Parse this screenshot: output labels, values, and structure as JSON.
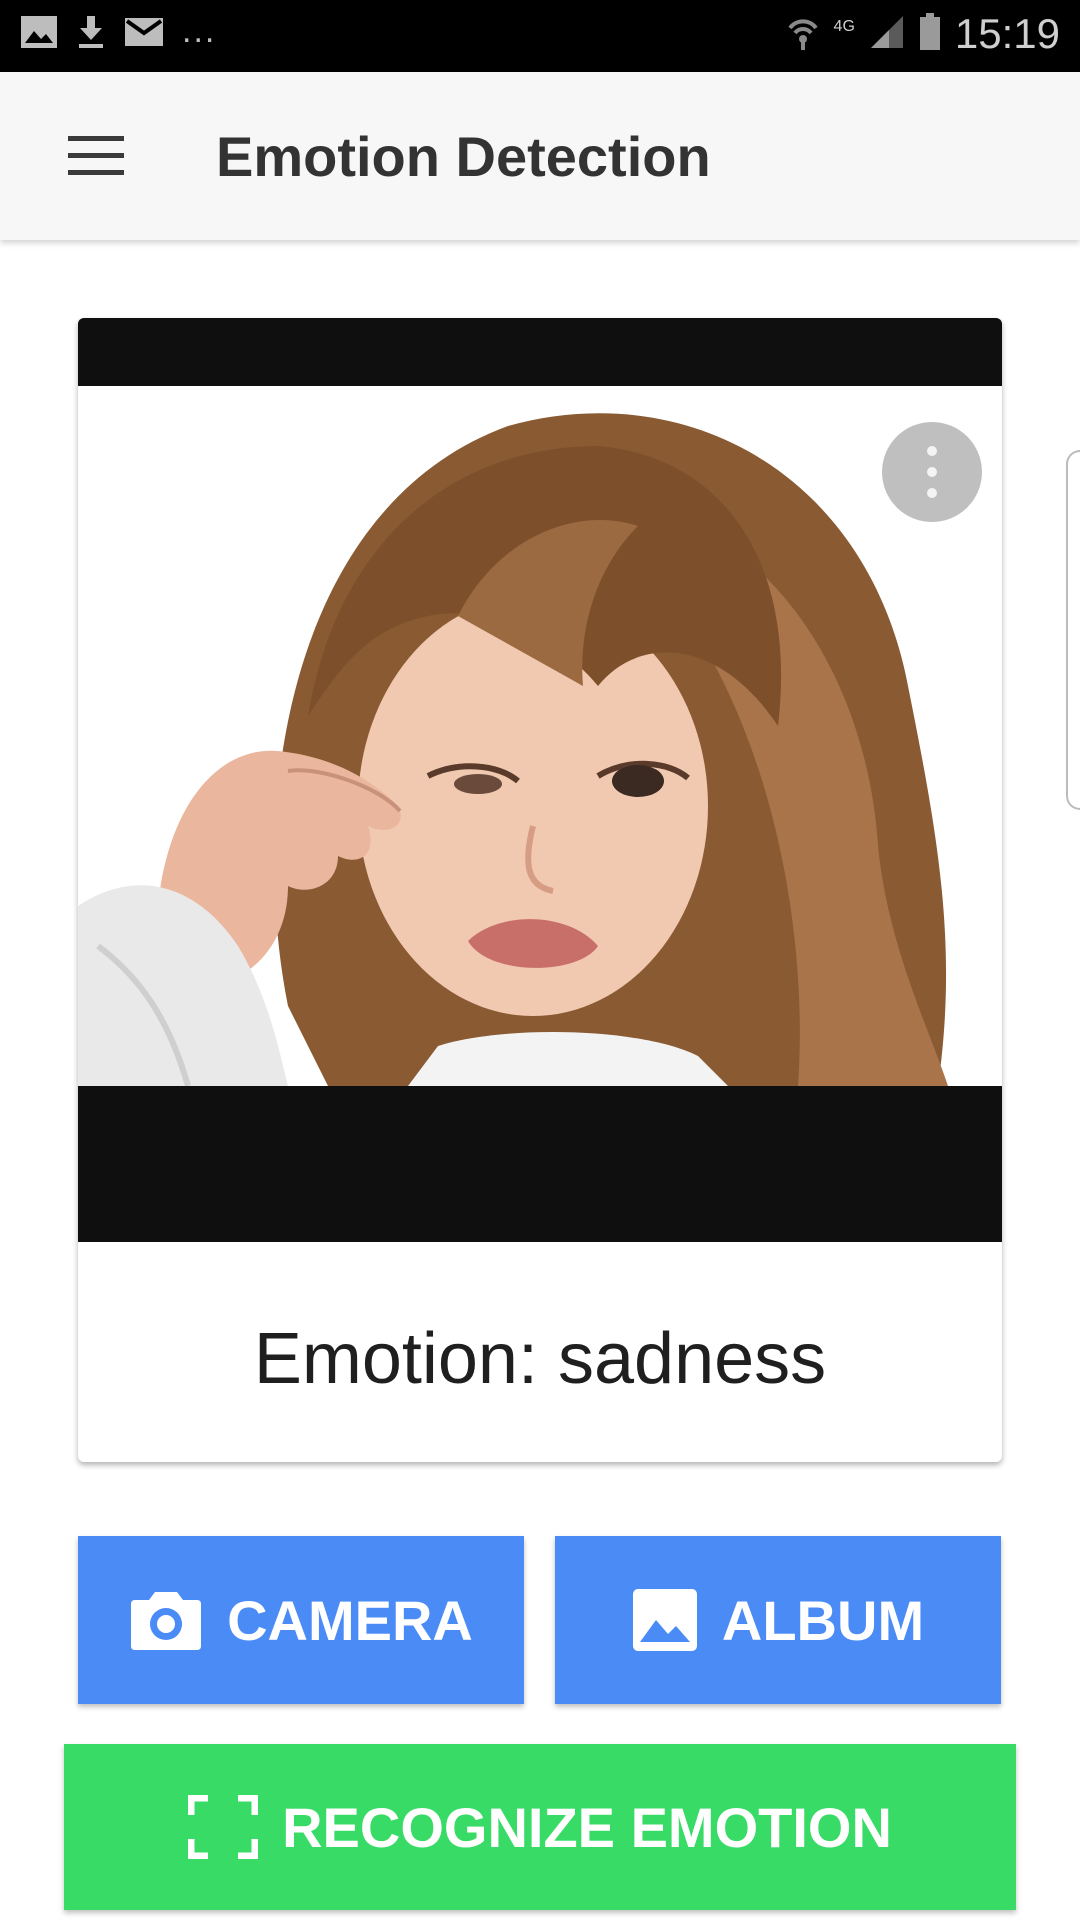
{
  "status_bar": {
    "left_icons": [
      "image-icon",
      "download-icon",
      "mail-icon"
    ],
    "overflow": "...",
    "network": "4G",
    "time": "15:19"
  },
  "app_bar": {
    "menu_icon": "menu-icon",
    "title": "Emotion Detection"
  },
  "card": {
    "photo_icon": "more-vert-icon",
    "emotion_text": "Emotion: sadness"
  },
  "buttons": {
    "camera_label": "CAMERA",
    "camera_icon": "camera-icon",
    "album_label": "ALBUM",
    "album_icon": "image-icon",
    "recognize_label": "RECOGNIZE EMOTION",
    "recognize_icon": "focus-frame-icon"
  },
  "colors": {
    "accent_blue": "#4a8bf6",
    "accent_green": "#37db66",
    "appbar_bg": "#f7f7f7",
    "statusbar_bg": "#000000"
  }
}
